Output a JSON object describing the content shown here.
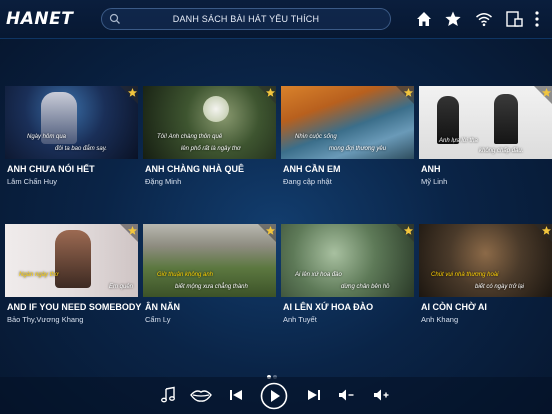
{
  "app": {
    "logo": "HANET"
  },
  "search": {
    "label": "DANH SÁCH BÀI HÁT YÊU THÍCH"
  },
  "toolbar_icons": [
    "home-icon",
    "star-icon",
    "wifi-icon",
    "device-icon",
    "more-vertical-icon"
  ],
  "songs": [
    {
      "title": "ANH CHƯA NÓI HẾT",
      "artist": "Lâm Chấn Huy",
      "lyric1": "Ngày hôm qua",
      "lyric2": "đôi ta bao đắm say."
    },
    {
      "title": "ANH CHÀNG NHÀ QUÊ",
      "artist": "Đặng Minh",
      "lyric1": "Tôi! Anh chàng thôn quê",
      "lyric2": "lên phố rất là ngây thơ"
    },
    {
      "title": "ANH CẦN EM",
      "artist": "Đang cập nhật",
      "lyric1": "Nhìn cuộc sống",
      "lyric2": "mong đợi thương yêu"
    },
    {
      "title": "ANH",
      "artist": "Mỹ Linh",
      "lyric1": "Anh lựa lời tha",
      "lyric2": "không chấp đâu."
    },
    {
      "title": "AND IF YOU NEED SOMEBODY",
      "artist": "Bảo Thy,Vương Khang",
      "lyric1": "Ngàn ngày thơ",
      "lyric2": "Em quên"
    },
    {
      "title": "ÂN NĂN",
      "artist": "Cẩm Ly",
      "lyric1": "Giờ thuận không anh",
      "lyric2": "biết mộng xưa chẳng thành"
    },
    {
      "title": "AI LÊN XỨ HOA ĐÀO",
      "artist": "Anh Tuyết",
      "lyric1": "Ai lên xứ hoa đào",
      "lyric2": "dừng chân bên hồ"
    },
    {
      "title": "AI CÒN CHỜ AI",
      "artist": "Anh Khang",
      "lyric1": "Chút vui nhà thương hoài",
      "lyric2": "biết có ngày trở lại"
    }
  ],
  "pagination": {
    "pages": 2,
    "current": 1
  },
  "player_icons": [
    "music-note-icon",
    "vocal-lips-icon",
    "previous-icon",
    "play-icon",
    "next-icon",
    "volume-down-icon",
    "volume-up-icon"
  ],
  "colors": {
    "background": "#0a2447",
    "accent_star": "#f2c53d",
    "lyric_highlight": "#ffd200"
  }
}
